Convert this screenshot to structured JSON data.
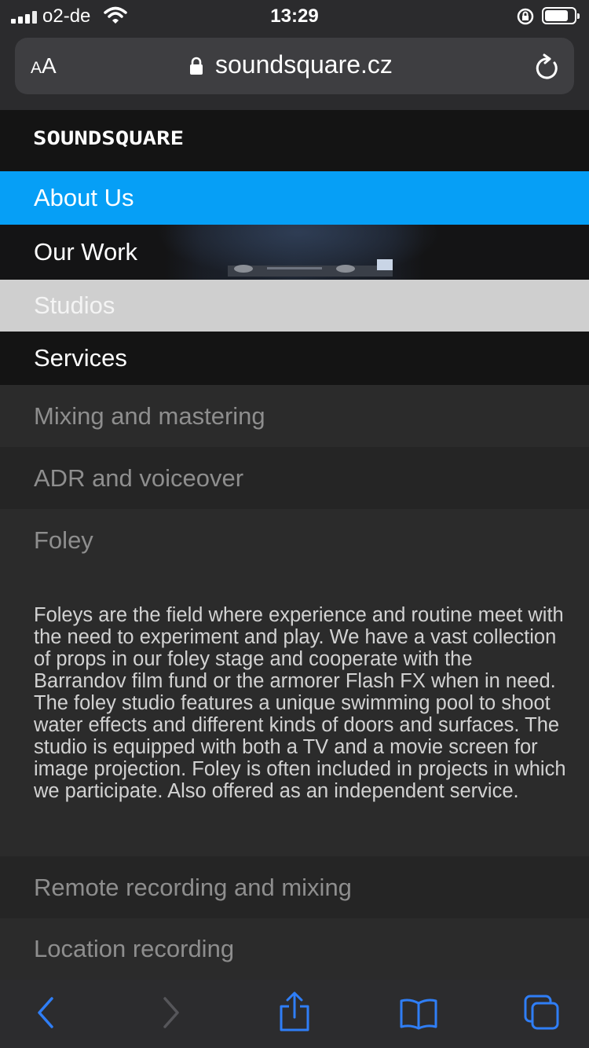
{
  "status_bar": {
    "carrier": "o2-de",
    "time": "13:29",
    "battery_level": 0.8,
    "icons": [
      "signal-icon",
      "wifi-icon",
      "orientation-lock-icon",
      "battery-icon"
    ]
  },
  "browser": {
    "text_size_label_small": "A",
    "text_size_label_large": "A",
    "domain": "soundsquare.cz",
    "icons": [
      "padlock-icon",
      "reload-icon"
    ]
  },
  "site": {
    "logo": "SOUNDSQUARE"
  },
  "nav": {
    "items": [
      {
        "label": "About Us",
        "state": "active"
      },
      {
        "label": "Our Work"
      },
      {
        "label": "Studios"
      },
      {
        "label": "Services"
      }
    ]
  },
  "services": {
    "items": [
      {
        "label": "Mixing and mastering"
      },
      {
        "label": "ADR and voiceover"
      },
      {
        "label": "Foley",
        "expanded": true,
        "description": "Foleys are the field where experience and routine meet with the need to experiment and play. We have a vast collection of props in our foley stage and cooperate with the Barrandov film fund or the armorer Flash FX when in need. The foley studio features a unique swimming pool to shoot water effects and different kinds of doors and surfaces. The studio is equipped with both a TV and a movie screen for image projection. Foley is often included in projects in which we participate. Also offered as an independent service."
      },
      {
        "label": "Remote recording and mixing"
      },
      {
        "label": "Location recording"
      }
    ]
  },
  "toolbar": {
    "icons": [
      "back-icon",
      "forward-icon",
      "share-icon",
      "bookmarks-icon",
      "tabs-icon"
    ]
  },
  "colors": {
    "accent": "#069ff6",
    "toolbar_icon": "#2f7ef6"
  }
}
